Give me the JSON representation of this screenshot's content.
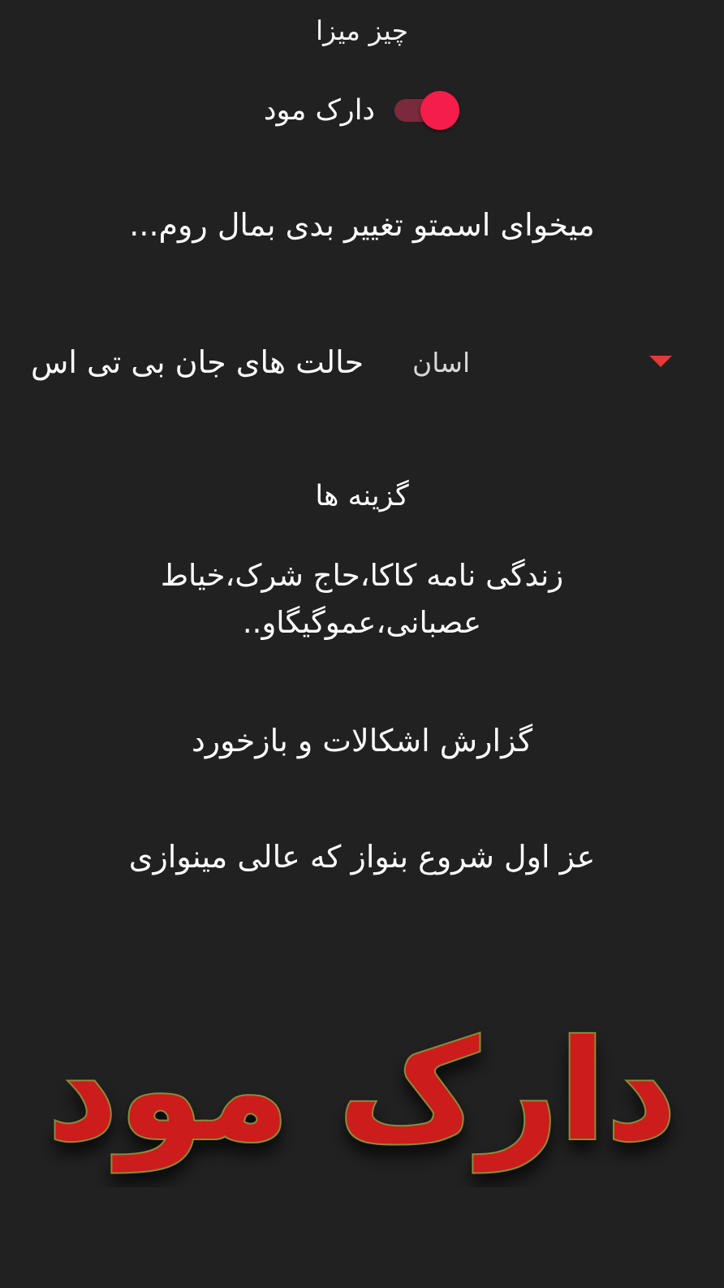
{
  "header": {
    "title": "چیز میزا"
  },
  "dark_mode": {
    "label": "دارک مود",
    "enabled": true
  },
  "room": {
    "text": "میخوای اسمتو تغییر بدی بمال روم..."
  },
  "spinner": {
    "label": "حالت های جان بی تی اس",
    "selected": "اسان"
  },
  "options": {
    "title": "گزینه ها",
    "items": [
      "زندگی نامه کاکا،حاج شرک،خیاط عصبانی،عموگیگاو..",
      "گزارش اشکالات و بازخورد",
      "عز اول شروع بنواز که عالی مینوازی"
    ]
  },
  "watermark": {
    "text": "دارک مود",
    "fill_color": "#cc1f1a",
    "stroke_color": "#8a8a3a"
  },
  "colors": {
    "background": "#212121",
    "accent": "#f51d4a",
    "arrow": "#e53935"
  }
}
